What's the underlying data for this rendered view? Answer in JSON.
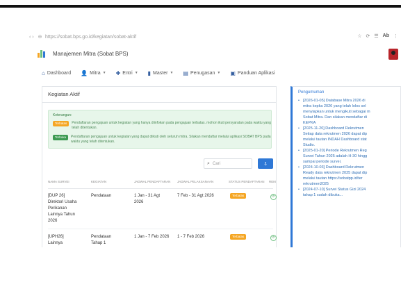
{
  "browser": {
    "url": "https://sobat.bps.go.id/kegiatan/sobat-aktif",
    "right_tools": [
      "☆",
      "⟳",
      "☰",
      "Ab",
      "⋮"
    ]
  },
  "app": {
    "title": "Manajemen Mitra (Sobat BPS)",
    "logo_colors": [
      "#f5a623",
      "#6cc07f",
      "#2f78d6"
    ]
  },
  "nav": {
    "items": [
      {
        "icon": "home-icon",
        "glyph": "⌂",
        "label": "Dashboard",
        "has_caret": false
      },
      {
        "icon": "user-icon",
        "glyph": "👤",
        "label": "Mitra",
        "has_caret": true
      },
      {
        "icon": "plus-icon",
        "glyph": "✚",
        "label": "Entri",
        "has_caret": true
      },
      {
        "icon": "database-icon",
        "glyph": "▮",
        "label": "Master",
        "has_caret": true
      },
      {
        "icon": "assignment-icon",
        "glyph": "▤",
        "label": "Penugasan",
        "has_caret": true
      },
      {
        "icon": "guide-icon",
        "glyph": "▣",
        "label": "Panduan Aplikasi",
        "has_caret": false
      }
    ]
  },
  "card": {
    "title": "Kegiatan Aktif",
    "notice": {
      "heading": "Keterangan:",
      "rows": [
        {
          "badge": "Terbatas",
          "badge_color": "#f5a623",
          "text": "Pendaftaran pengajuan untuk kegiatan yang hanya diinfokan pada pengajuan terbatas. mohon ikuti persyaratan pada waktu yang telah ditentukan."
        },
        {
          "badge": "Terbuka",
          "badge_color": "#3c9a52",
          "text": "Pendaftaran pengajuan untuk kegiatan yang dapat diikuti oleh seluruh mitra. Silakan mendaftar melalui aplikasi SOBAT BPS pada waktu yang telah ditentukan."
        }
      ]
    },
    "search_placeholder": "Cari",
    "download_glyph": "⇩",
    "table": {
      "headers": [
        "NAMA SURVEI",
        "KEGIATAN",
        "JADWAL PENDAFTARAN",
        "JADWAL PELAKSANAAN",
        "STATUS PENDAFTARAN",
        "REKRUTMEN"
      ],
      "rows": [
        {
          "name_lines": [
            "[DUP 26]",
            "Direktori Usaha",
            "Perikanan",
            "Lainnya Tahun",
            "2026"
          ],
          "kegiatan": "Pendataan",
          "jadwal_pendaftaran_lines": [
            "1 Jan - 31 Agt",
            "2026"
          ],
          "jadwal_pelaksanaan": "7 Feb - 31 Agt 2026",
          "status": "Terbatas",
          "action": "⟳"
        },
        {
          "name_lines": [
            "[UPH26]",
            "Lainnya"
          ],
          "kegiatan_lines": [
            "Pendataan",
            "Tahap 1"
          ],
          "jadwal_pendaftaran_lines": [
            "1 Jan - 7 Feb 2026"
          ],
          "jadwal_pelaksanaan": "1 - 7 Feb 2026",
          "status": "Terbatas",
          "action": "⟳"
        }
      ]
    }
  },
  "side": {
    "title": "Pengumuman",
    "items": [
      [
        "[2026-01-05] Database Mitra 2026 di",
        "mitra kepka 2026 yang telah lolos sel",
        "menyiapkan untuk mengikuti sebagai m",
        "Sobat Mitra. Dan silakan mendaftar di",
        "KEPKA"
      ],
      [
        "[2025-11-20] Dashboard Rekrutmen",
        "Setiap data rekrutmen 2026 dapat dip",
        "melalui tautan INDAH Dashboard stat",
        "Studio."
      ],
      [
        "[2025-01-20] Periode Rekrutmen Reg",
        "Survei Tahun 2025 adalah H-30 hingg",
        "sampai periode survei."
      ],
      [
        "[2024-10-03] Dashboard Rekrutmen",
        "Ready data rekrutmen 2025 dapat dip",
        "melalui tautan https://sobatpp.id/ter",
        "rekrutmen2025"
      ],
      [
        "[2024-07-10] Survei Status Gizi 2024",
        "tahap 1 sudah dibuka..."
      ]
    ]
  }
}
